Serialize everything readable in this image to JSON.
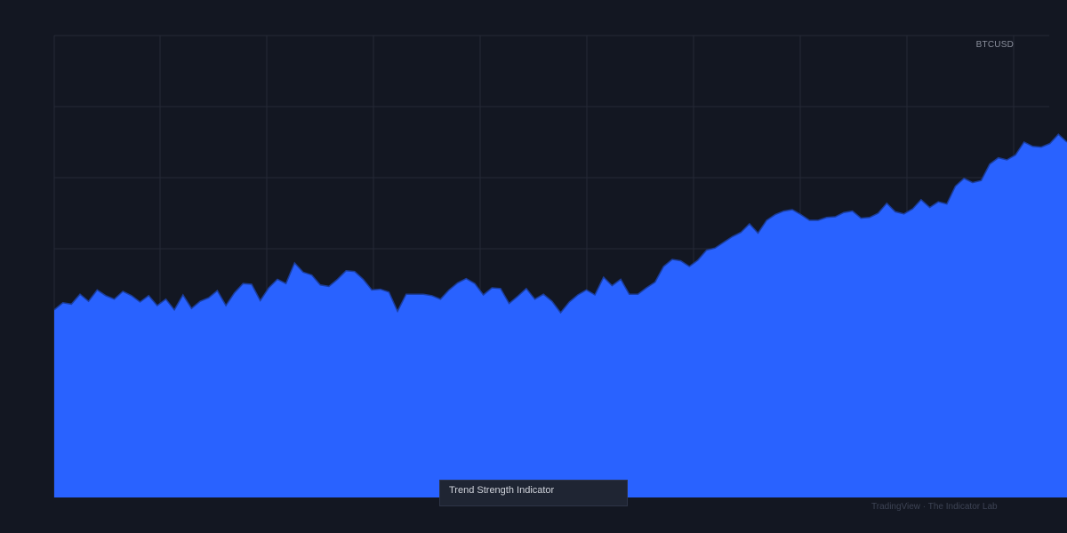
{
  "symbol": "BTCUSD",
  "indicator_label": "Trend Strength Indicator",
  "watermark": "TradingView · The Indicator Lab",
  "colors": {
    "background": "#131722",
    "grid": "#242836",
    "area_fill": "#2962ff",
    "area_stroke": "#1b3e9e"
  },
  "chart_data": {
    "type": "area",
    "title": "",
    "xlabel": "",
    "ylabel": "",
    "grid": true,
    "ylim": [
      0,
      650
    ],
    "x": [
      0,
      12,
      24,
      36,
      48,
      60,
      72,
      84,
      96,
      108,
      120,
      132,
      144,
      156,
      168,
      180,
      192,
      204,
      216,
      228,
      240,
      252,
      264,
      276,
      288,
      300,
      312,
      324,
      336,
      348,
      360,
      372,
      384,
      396,
      408,
      420,
      432,
      444,
      456,
      468,
      480,
      492,
      504,
      516,
      528,
      540,
      552,
      564,
      576,
      588,
      600,
      612,
      624,
      636,
      648,
      660,
      672,
      684,
      696,
      708,
      720,
      732,
      744,
      756,
      768,
      780,
      792,
      804,
      816,
      828,
      840,
      852,
      864,
      876,
      888,
      900,
      912,
      924,
      936,
      948,
      960,
      972,
      984,
      996,
      1008,
      1020,
      1032,
      1044,
      1056,
      1068,
      1080,
      1092,
      1104,
      1116,
      1128,
      1140,
      1152,
      1164,
      1176,
      1188,
      1200,
      1212,
      1224,
      1236,
      1248,
      1260,
      1272,
      1284,
      1296,
      1308,
      1320,
      1332,
      1344,
      1356,
      1368,
      1380,
      1392,
      1404,
      1416
    ],
    "series": [
      {
        "values": [
          264,
          274,
          272,
          286,
          276,
          292,
          284,
          279,
          290,
          284,
          275,
          284,
          270,
          279,
          264,
          285,
          266,
          276,
          281,
          291,
          270,
          288,
          301,
          300,
          277,
          295,
          307,
          301,
          330,
          317,
          313,
          299,
          297,
          307,
          319,
          318,
          307,
          292,
          293,
          289,
          262,
          286,
          286,
          286,
          284,
          279,
          292,
          302,
          308,
          301,
          285,
          295,
          294,
          273,
          283,
          294,
          279,
          286,
          276,
          260,
          275,
          285,
          292,
          285,
          310,
          298,
          307,
          286,
          286,
          295,
          303,
          325,
          335,
          333,
          325,
          334,
          348,
          351,
          359,
          367,
          373,
          385,
          372,
          390,
          398,
          403,
          405,
          398,
          390,
          390,
          394,
          395,
          401,
          403,
          393,
          394,
          400,
          414,
          402,
          399,
          406,
          419,
          408,
          416,
          413,
          438,
          449,
          443,
          446,
          469,
          478,
          475,
          482,
          500,
          494,
          493,
          498,
          511,
          500
        ]
      }
    ]
  }
}
